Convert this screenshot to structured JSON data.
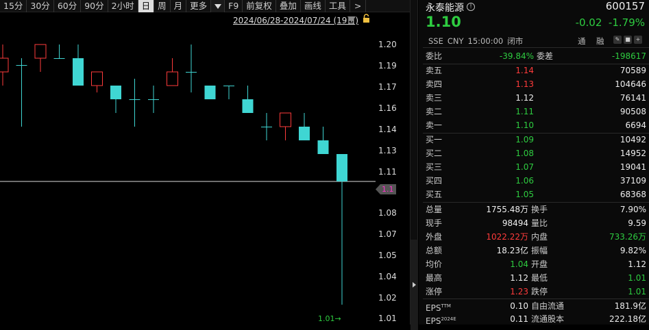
{
  "toolbar": {
    "items": [
      "15分",
      "30分",
      "60分",
      "90分",
      "2小时",
      "日",
      "周",
      "月",
      "更多",
      "F9",
      "前复权",
      "叠加",
      "画线",
      "工具",
      ">"
    ],
    "active": "日"
  },
  "chart_header": {
    "range": "2024/06/28-2024/07/24 (19日)"
  },
  "chart_data": {
    "type": "candlestick",
    "y_ticks": [
      "1.20",
      "1.19",
      "1.17",
      "1.16",
      "1.14",
      "1.13",
      "1.11",
      "1.08",
      "1.07",
      "1.05",
      "1.04",
      "1.02",
      "1.01"
    ],
    "current_price_tag": "1.1",
    "low_label": "1.01",
    "candles": [
      {
        "o": 1.18,
        "h": 1.2,
        "l": 1.17,
        "c": 1.19
      },
      {
        "o": 1.185,
        "h": 1.19,
        "l": 1.14,
        "c": 1.185
      },
      {
        "o": 1.19,
        "h": 1.2,
        "l": 1.18,
        "c": 1.2
      },
      {
        "o": 1.19,
        "h": 1.2,
        "l": 1.19,
        "c": 1.19
      },
      {
        "o": 1.19,
        "h": 1.2,
        "l": 1.17,
        "c": 1.17
      },
      {
        "o": 1.17,
        "h": 1.18,
        "l": 1.165,
        "c": 1.18
      },
      {
        "o": 1.17,
        "h": 1.17,
        "l": 1.15,
        "c": 1.16
      },
      {
        "o": 1.16,
        "h": 1.175,
        "l": 1.14,
        "c": 1.16
      },
      {
        "o": 1.16,
        "h": 1.17,
        "l": 1.15,
        "c": 1.16
      },
      {
        "o": 1.17,
        "h": 1.19,
        "l": 1.17,
        "c": 1.18
      },
      {
        "o": 1.18,
        "h": 1.2,
        "l": 1.165,
        "c": 1.18
      },
      {
        "o": 1.17,
        "h": 1.17,
        "l": 1.16,
        "c": 1.16
      },
      {
        "o": 1.17,
        "h": 1.17,
        "l": 1.16,
        "c": 1.17
      },
      {
        "o": 1.16,
        "h": 1.17,
        "l": 1.15,
        "c": 1.15
      },
      {
        "o": 1.14,
        "h": 1.15,
        "l": 1.13,
        "c": 1.14
      },
      {
        "o": 1.14,
        "h": 1.15,
        "l": 1.13,
        "c": 1.15
      },
      {
        "o": 1.14,
        "h": 1.15,
        "l": 1.13,
        "c": 1.13
      },
      {
        "o": 1.13,
        "h": 1.14,
        "l": 1.12,
        "c": 1.12
      },
      {
        "o": 1.12,
        "h": 1.12,
        "l": 1.01,
        "c": 1.1
      }
    ]
  },
  "stock": {
    "name": "永泰能源",
    "code": "600157",
    "price": "1.10",
    "change": "-0.02",
    "change_pct": "-1.79%",
    "exchange": "SSE",
    "currency": "CNY",
    "time": "15:00:00",
    "status": "闭市",
    "tong": "通",
    "rong": "融"
  },
  "ratio": {
    "label1": "委比",
    "value1": "-39.84%",
    "label2": "委差",
    "value2": "-198617"
  },
  "asks": [
    {
      "label": "卖五",
      "price": "1.14",
      "vol": "70589",
      "color": "red"
    },
    {
      "label": "卖四",
      "price": "1.13",
      "vol": "104646",
      "color": "red"
    },
    {
      "label": "卖三",
      "price": "1.12",
      "vol": "76141",
      "color": "white"
    },
    {
      "label": "卖二",
      "price": "1.11",
      "vol": "90508",
      "color": "green"
    },
    {
      "label": "卖一",
      "price": "1.10",
      "vol": "6694",
      "color": "green"
    }
  ],
  "bids": [
    {
      "label": "买一",
      "price": "1.09",
      "vol": "10492",
      "color": "green"
    },
    {
      "label": "买二",
      "price": "1.08",
      "vol": "14952",
      "color": "green"
    },
    {
      "label": "买三",
      "price": "1.07",
      "vol": "19041",
      "color": "green"
    },
    {
      "label": "买四",
      "price": "1.06",
      "vol": "37109",
      "color": "green"
    },
    {
      "label": "买五",
      "price": "1.05",
      "vol": "68368",
      "color": "green"
    }
  ],
  "stats": [
    {
      "l1": "总量",
      "v1": "1755.48万",
      "c1": "white",
      "l2": "换手",
      "v2": "7.90%",
      "c2": "white"
    },
    {
      "l1": "现手",
      "v1": "98494",
      "c1": "white",
      "l2": "量比",
      "v2": "9.59",
      "c2": "white"
    },
    {
      "l1": "外盘",
      "v1": "1022.22万",
      "c1": "red",
      "l2": "内盘",
      "v2": "733.26万",
      "c2": "green"
    },
    {
      "l1": "总额",
      "v1": "18.23亿",
      "c1": "white",
      "l2": "振幅",
      "v2": "9.82%",
      "c2": "white"
    },
    {
      "l1": "均价",
      "v1": "1.04",
      "c1": "green",
      "l2": "开盘",
      "v2": "1.12",
      "c2": "white"
    },
    {
      "l1": "最高",
      "v1": "1.12",
      "c1": "white",
      "l2": "最低",
      "v2": "1.01",
      "c2": "green"
    },
    {
      "l1": "涨停",
      "v1": "1.23",
      "c1": "red",
      "l2": "跌停",
      "v2": "1.01",
      "c2": "green"
    }
  ],
  "eps": [
    {
      "l1": "EPS",
      "sup": "TTM",
      "v1": "0.10",
      "l2": "自由流通",
      "v2": "181.9亿"
    },
    {
      "l1": "EPS",
      "sup": "2024E",
      "v1": "0.11",
      "l2": "流通股本",
      "v2": "222.18亿"
    }
  ]
}
